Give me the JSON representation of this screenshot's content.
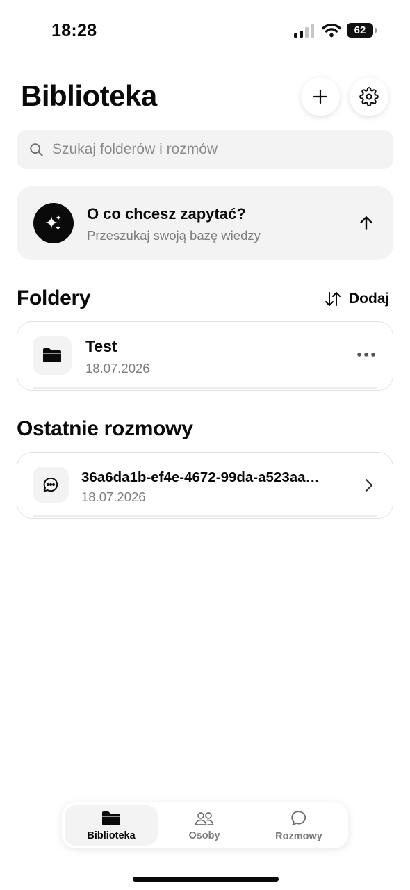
{
  "status_bar": {
    "time": "18:28",
    "battery": "62"
  },
  "header": {
    "title": "Biblioteka"
  },
  "search": {
    "placeholder": "Szukaj folderów i rozmów"
  },
  "ask_card": {
    "title": "O co chcesz zapytać?",
    "subtitle": "Przeszukaj swoją bazę wiedzy"
  },
  "folders": {
    "title": "Foldery",
    "add_label": "Dodaj",
    "items": [
      {
        "name": "Test",
        "date": "18.07.2026"
      }
    ]
  },
  "recent": {
    "title": "Ostatnie rozmowy",
    "items": [
      {
        "name": "36a6da1b-ef4e-4672-99da-a523aa…",
        "date": "18.07.2026"
      }
    ]
  },
  "tab_bar": {
    "active": "Biblioteka",
    "tabs": [
      {
        "label": "Biblioteka",
        "icon": "folder-icon"
      },
      {
        "label": "Osoby",
        "icon": "people-icon"
      },
      {
        "label": "Rozmowy",
        "icon": "chat-bubble-icon"
      }
    ]
  },
  "icons": {
    "add": "plus-icon",
    "settings": "gear-icon",
    "search": "search-icon",
    "ask": "sparkles-icon",
    "submit": "arrow-up-icon",
    "sort": "sort-arrows-icon",
    "folder": "folder-icon",
    "more": "more-dots-icon",
    "conversation": "chat-bubble-dots-icon",
    "chevron": "chevron-right-icon"
  },
  "colors": {
    "primary": "#0a0a0a",
    "surface": "#f3f3f4",
    "muted_text": "#7d7d82",
    "border": "#e2e2e5"
  }
}
